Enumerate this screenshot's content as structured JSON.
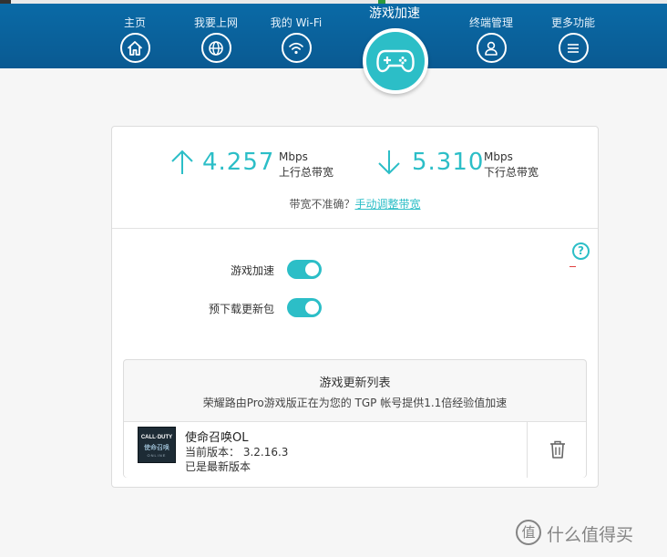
{
  "nav": {
    "items": [
      {
        "label": "主页",
        "icon": "home-icon"
      },
      {
        "label": "我要上网",
        "icon": "globe-icon"
      },
      {
        "label": "我的 Wi-Fi",
        "icon": "wifi-icon"
      },
      {
        "label": "游戏加速",
        "icon": "gamepad-icon",
        "active": true
      },
      {
        "label": "终端管理",
        "icon": "user-icon"
      },
      {
        "label": "更多功能",
        "icon": "menu-icon"
      }
    ]
  },
  "bandwidth": {
    "upload": {
      "value": "4.257",
      "unit": "Mbps",
      "label": "上行总带宽"
    },
    "download": {
      "value": "5.310",
      "unit": "Mbps",
      "label": "下行总带宽"
    },
    "hint": "带宽不准确？",
    "hint_link": "手动调整带宽"
  },
  "settings": {
    "help": "?",
    "game_accel": {
      "label": "游戏加速",
      "on": true
    },
    "predownload": {
      "label": "预下载更新包",
      "on": true
    }
  },
  "update_list": {
    "title": "游戏更新列表",
    "subtitle": "荣耀路由Pro游戏版正在为您的 TGP 帐号提供1.1倍经验值加速",
    "games": [
      {
        "name": "使命召唤OL",
        "version": "当前版本： 3.2.16.3",
        "status": "已是最新版本",
        "thumb_line1": "CALL·DUTY",
        "thumb_line2": "使命召唤",
        "thumb_line3": "ONLINE"
      }
    ]
  },
  "watermark": {
    "symbol": "值",
    "text": "什么值得买"
  },
  "colors": {
    "nav_bg": "#0a5f9c",
    "accent": "#2cbec7"
  }
}
